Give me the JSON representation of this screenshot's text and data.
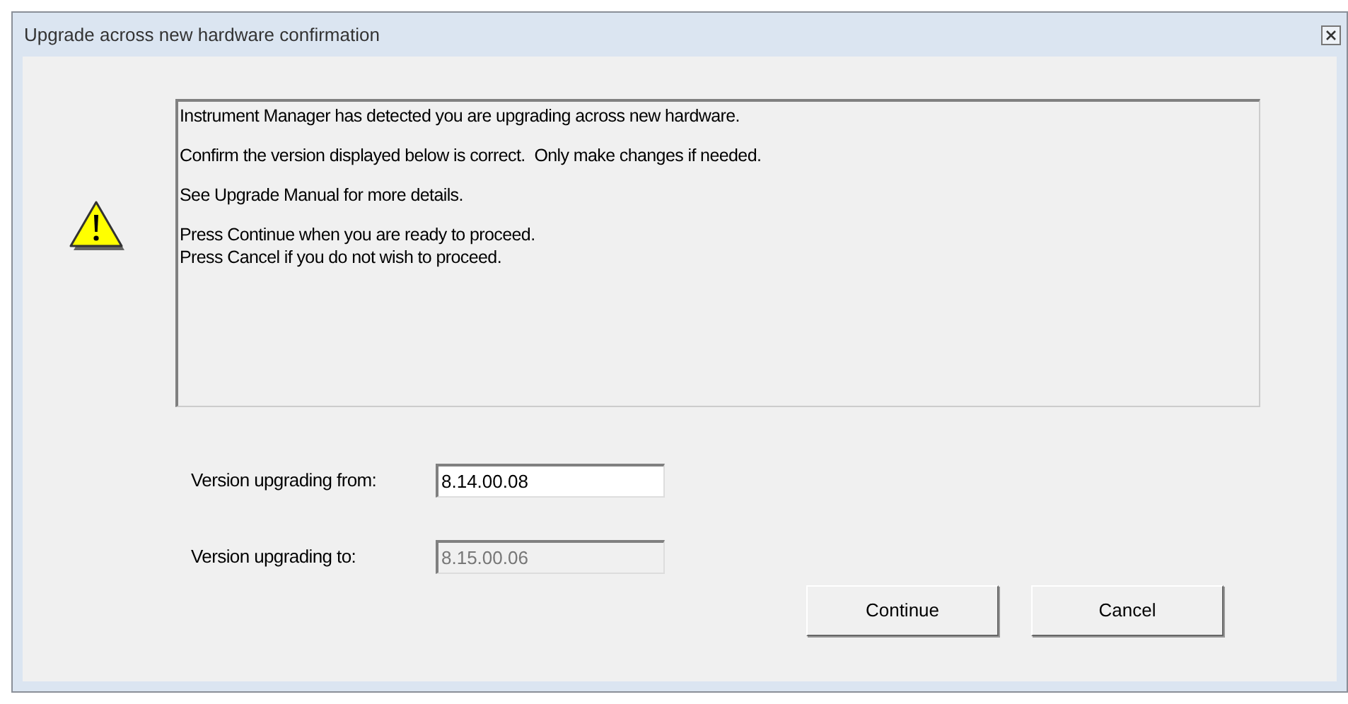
{
  "window": {
    "title": "Upgrade across new hardware confirmation"
  },
  "message": [
    [
      "Instrument Manager has detected you are upgrading across new hardware."
    ],
    [
      "Confirm the version displayed below is correct.  Only make changes if needed."
    ],
    [
      "See Upgrade Manual for more details."
    ],
    [
      "Press Continue when you are ready to proceed.",
      "Press Cancel if you do not wish to proceed."
    ]
  ],
  "fields": [
    {
      "label": "Version upgrading from:",
      "value": "8.14.00.08",
      "disabled": false
    },
    {
      "label": "Version upgrading to:",
      "value": "8.15.00.06",
      "disabled": true
    }
  ],
  "buttons": [
    "Continue",
    "Cancel"
  ]
}
